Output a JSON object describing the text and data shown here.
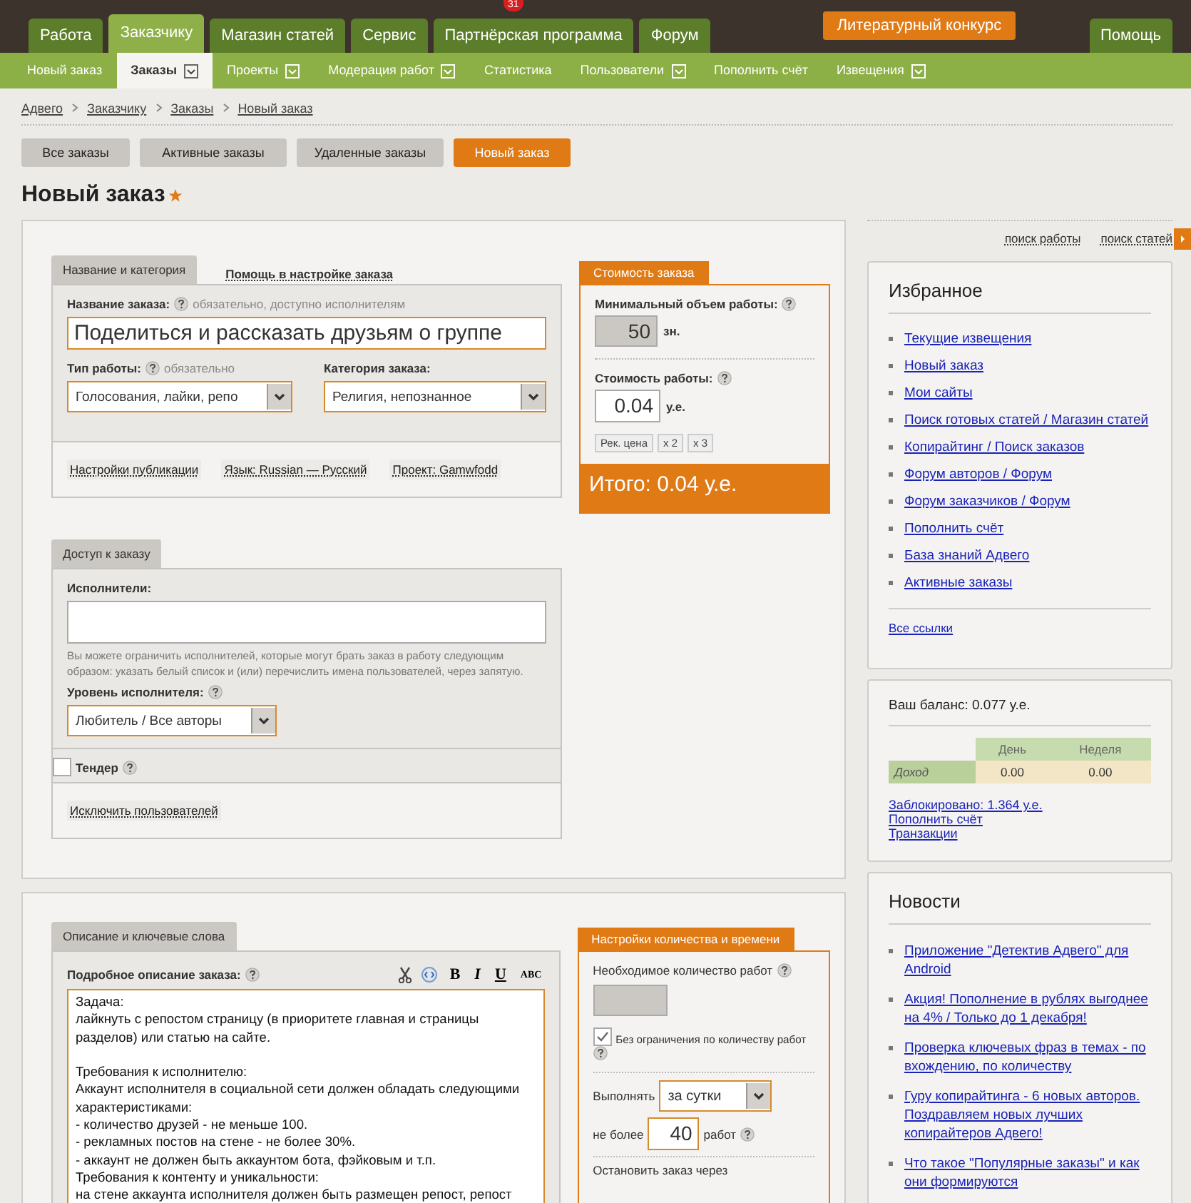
{
  "notification_badge": "31",
  "top_nav": [
    {
      "label": "Работа",
      "selected": false
    },
    {
      "label": "Заказчику",
      "selected": true
    },
    {
      "label": "Магазин статей",
      "selected": false
    },
    {
      "label": "Сервис",
      "selected": false
    },
    {
      "label": "Партнёрская программа",
      "selected": false
    },
    {
      "label": "Форум",
      "selected": false
    }
  ],
  "promo_button": "Литературный конкурс",
  "help_button": "Помощь",
  "sub_nav": [
    {
      "label": "Новый заказ",
      "selected": false,
      "dropdown": false
    },
    {
      "label": "Заказы",
      "selected": true,
      "dropdown": true
    },
    {
      "label": "Проекты",
      "selected": false,
      "dropdown": true
    },
    {
      "label": "Модерация работ",
      "selected": false,
      "dropdown": true
    },
    {
      "label": "Статистика",
      "selected": false,
      "dropdown": false
    },
    {
      "label": "Пользователи",
      "selected": false,
      "dropdown": true
    },
    {
      "label": "Пополнить счёт",
      "selected": false,
      "dropdown": false
    },
    {
      "label": "Извещения",
      "selected": false,
      "dropdown": true
    }
  ],
  "breadcrumbs": [
    "Адвего",
    "Заказчику",
    "Заказы",
    "Новый заказ"
  ],
  "order_tabs": [
    {
      "label": "Все заказы",
      "selected": false
    },
    {
      "label": "Активные заказы",
      "selected": false
    },
    {
      "label": "Удаленные заказы",
      "selected": false
    },
    {
      "label": "Новый заказ",
      "selected": true
    }
  ],
  "page_title": "Новый заказ",
  "starred": true,
  "search_links": [
    "поиск работы",
    "поиск статей"
  ],
  "name_section": {
    "tabs": [
      {
        "label": "Название и категория",
        "selected": true
      },
      {
        "label": "Помощь в настройке заказа",
        "selected": false
      }
    ],
    "name_label": "Название заказа:",
    "name_hint": "обязательно, доступно исполнителям",
    "name_value": "Поделиться и рассказать друзьям о группе",
    "work_type": {
      "label": "Тип работы:",
      "hint": "обязательно",
      "value": "Голосования, лайки, репо"
    },
    "category": {
      "label": "Категория заказа:",
      "value": "Религия, непознанное"
    },
    "links": [
      "Настройки публикации",
      "Язык: Russian — Русский",
      "Проект: Gamwfodd"
    ]
  },
  "cost": {
    "title": "Стоимость заказа",
    "min_volume_label": "Минимальный объем работы:",
    "min_volume_value": "50",
    "min_volume_unit": "зн.",
    "price_label": "Стоимость работы:",
    "price_value": "0.04",
    "price_unit": "у.е.",
    "buttons": [
      "Рек. цена",
      "x 2",
      "x 3"
    ],
    "total": "Итого: 0.04 у.е."
  },
  "access": {
    "tab": "Доступ к заказу",
    "performers_label": "Исполнители:",
    "help_text": "Вы можете ограничить исполнителей, которые могут брать заказ в работу следующим образом: указать белый список и (или) перечислить имена пользователей, через запятую.",
    "level_label": "Уровень исполнителя:",
    "level_value": "Любитель / Все авторы",
    "tender": {
      "label": "Тендер",
      "checked": false
    },
    "exclude_link": "Исключить пользователей"
  },
  "description": {
    "tab": "Описание и ключевые слова",
    "label": "Подробное описание заказа:",
    "format_buttons": [
      "B",
      "I",
      "U",
      "ABC"
    ],
    "text": "Задача:\nлайкнуть с репостом страницу (в приоритете главная и страницы разделов) или статью на сайте.\n\nТребования к исполнителю:\nАккаунт исполнителя в социальной сети должен обладать следующими характеристиками:\n- количество друзей - не меньше 100.\n- рекламных постов на стене - не более 30%.\n- аккаунт не должен быть аккаунтом бота, фэйковым и т.п.\nТребования к контенту и уникальности:\nна стене аккаунта исполнителя должен быть размещен репост, репост"
  },
  "quantity": {
    "tab": "Настройки количества и времени",
    "required_label": "Необходимое количество работ",
    "unlimited": {
      "label": "Без ограничения по количеству работ",
      "checked": true
    },
    "execute_label": "Выполнять",
    "execute_value": "за сутки",
    "not_more_label": "не более",
    "not_more_value": "40",
    "works_label": "работ",
    "stop_label": "Остановить заказ через"
  },
  "favorites": {
    "title": "Избранное",
    "links": [
      "Текущие извещения",
      "Новый заказ",
      "Мои сайты",
      "Поиск готовых статей / Магазин статей",
      "Копирайтинг / Поиск заказов",
      "Форум авторов / Форум",
      "Форум заказчиков / Форум",
      "Пополнить счёт",
      "База знаний Адвего",
      "Активные заказы"
    ],
    "all_links": "Все ссылки"
  },
  "balance": {
    "title": "Ваш баланс: 0.077 у.е.",
    "columns": [
      "День",
      "Неделя"
    ],
    "rows": [
      {
        "label": "Доход",
        "values": [
          "0.00",
          "0.00"
        ]
      }
    ],
    "links": [
      "Заблокировано: 1.364 у.е.",
      "Пополнить счёт",
      "Транзакции"
    ]
  },
  "news": {
    "title": "Новости",
    "items": [
      "Приложение \"Детектив Адвего\" для Android",
      "Акция! Пополнение в рублях выгоднее на 4% / Только до 1 декабря!",
      "Проверка ключевых фраз в темах - по вхождению, по количеству",
      "Гуру копирайтинга - 6 новых авторов. Поздравляем новых лучших копирайтеров Адвего!",
      "Что такое \"Популярные заказы\" и как они формируются"
    ]
  }
}
